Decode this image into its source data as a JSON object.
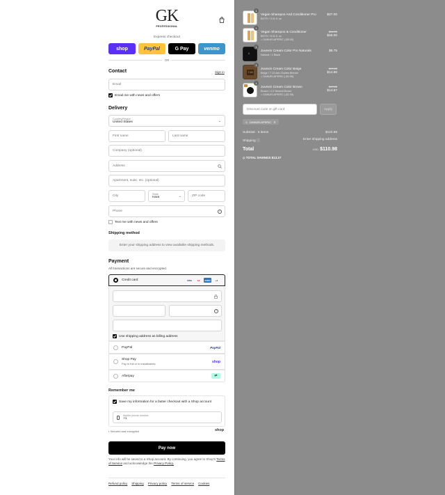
{
  "brand": {
    "logo_text": "GK",
    "logo_sub": "PROFESSIONAL"
  },
  "express": {
    "label": "Express checkout",
    "buttons": {
      "shop": "shop",
      "paypal": "PayPal",
      "gpay": "G Pay",
      "venmo": "venmo"
    },
    "or": "OR"
  },
  "contact": {
    "title": "Contact",
    "sign_in": "Sign in",
    "email_placeholder": "Email",
    "email_news": "Email me with news and offers"
  },
  "delivery": {
    "title": "Delivery",
    "country_label": "Country/Region",
    "country_value": "United States",
    "first_name": "First name",
    "last_name": "Last name",
    "company": "Company (optional)",
    "address": "Address",
    "apartment": "Apartment, suite, etc. (optional)",
    "city": "City",
    "state_label": "State",
    "state_value": "Iowa",
    "zip": "ZIP code",
    "phone": "Phone",
    "text_news": "Text me with news and offers"
  },
  "shipping": {
    "title": "Shipping method",
    "info": "Enter your shipping address to view available shipping methods."
  },
  "payment": {
    "title": "Payment",
    "subtitle": "All transactions are secure and encrypted.",
    "credit_card": "Credit card",
    "cards": [
      "VISA",
      "MC",
      "AMEX",
      "+4"
    ],
    "use_shipping": "Use shipping address as billing address",
    "paypal": "PayPal",
    "shop_pay": "Shop Pay",
    "shop_pay_sub": "Pay in full or in installments",
    "afterpay": "Afterpay"
  },
  "remember": {
    "title": "Remember me",
    "save_info": "Save my information for a faster checkout with a Shop account",
    "mobile_label": "Mobile phone number",
    "mobile_value": "+1",
    "secure": "Secured and encrypted",
    "shop": "shop"
  },
  "pay_now": "Pay now",
  "legal": {
    "text": "Your info will be saved to a Shop account. By continuing, you agree to Shop's",
    "tos": "Terms of Service",
    "and": "and acknowledge the",
    "privacy": "Privacy Policy."
  },
  "footer": [
    "Refund policy",
    "Shipping",
    "Privacy policy",
    "Terms of service",
    "Cookies"
  ],
  "cart": {
    "items": [
      {
        "qty": "1",
        "name": "Vegan Shampoo And Conditioner Pro",
        "sub": "BOTH / 3.11 fl. oz",
        "code": "",
        "price": "$27.00",
        "old_price": ""
      },
      {
        "qty": "1",
        "name": "Vegan Shampoo & Conditioner",
        "sub": "BOTH / 8.11 fl. oz",
        "code": "DANUELAPERIC (-$9.00)",
        "price": "$45.00",
        "old_price": "$54.00"
      },
      {
        "qty": "1",
        "name": "Juvexin Cream Color Pro Naturals",
        "sub": "Natural / 1 Black",
        "code": "",
        "price": "$8.75",
        "old_price": ""
      },
      {
        "qty": "1",
        "name": "Juvexin Cream Color Beige",
        "sub": "Beige / 7.13 Ash Golden Blonde",
        "code": "DANUELAPERIC (-$2.99)",
        "price": "$14.86",
        "old_price": "$17.85"
      },
      {
        "qty": "1",
        "name": "Juvexin Cream Color Brown",
        "sub": "Brown / 4.0 Neutral Brown",
        "code": "DANUELAPERIC (-$2.99)",
        "price": "$14.87",
        "old_price": "$17.85"
      }
    ],
    "discount_placeholder": "Discount code or gift card",
    "apply": "Apply",
    "applied_code": "DANUELAPERIC",
    "subtotal_label": "Subtotal · 5 items",
    "subtotal_value": "$110.98",
    "shipping_label": "Shipping",
    "shipping_value": "Enter shipping address",
    "total_label": "Total",
    "total_currency": "USD",
    "total_value": "$110.98",
    "savings": "TOTAL SAVINGS  $13.27"
  },
  "colors": {
    "shop": "#5a31f4",
    "paypal": "#ffc439",
    "gpay": "#000000",
    "venmo": "#3d95ce",
    "panel": "#8c8c8c"
  }
}
